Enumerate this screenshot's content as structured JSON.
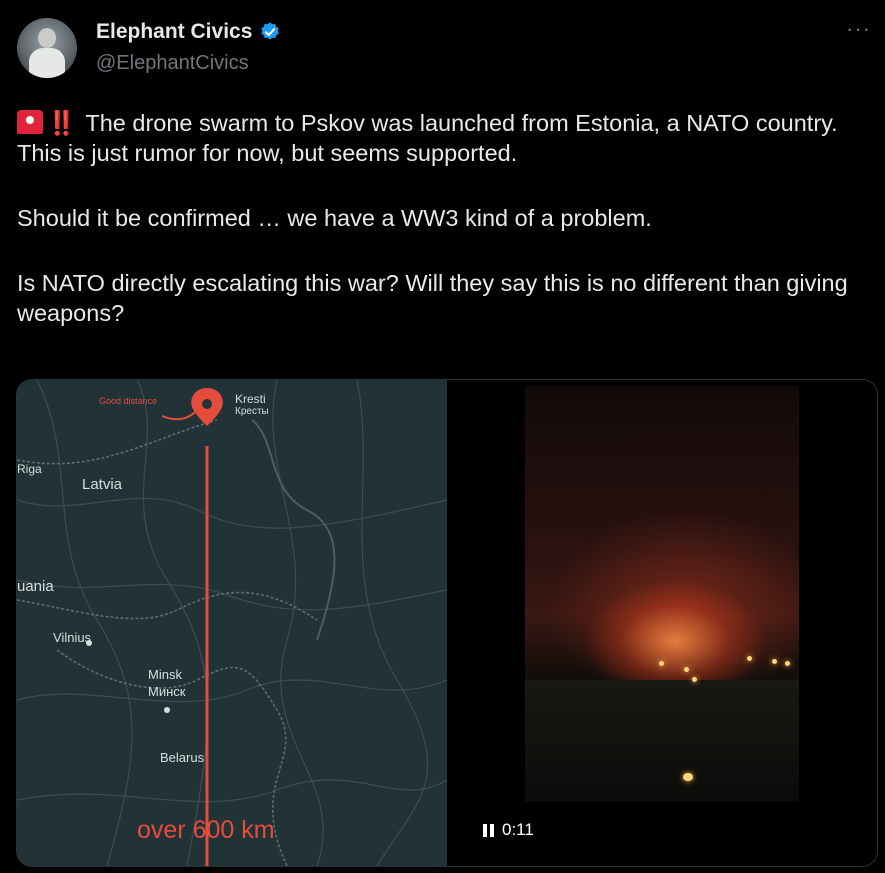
{
  "author": {
    "display_name": "Elephant Civics",
    "handle": "@ElephantCivics",
    "verified_icon": "verified-badge-icon",
    "verified_color": "#1d9bf0"
  },
  "more_label": "···",
  "tweet": {
    "p1_alert": "‼️",
    "p1_text": "The drone swarm to Pskov was launched from Estonia, a NATO country. This is just rumor for now, but seems supported.",
    "p2": "Should it be confirmed … we have a WW3 kind of a problem.",
    "p3": "Is NATO directly escalating this war? Will they say this is no different than giving weapons?"
  },
  "map": {
    "good_distance": "Good distance",
    "kresti": "Kresti",
    "kresti_cyr": "Кресты",
    "riga": "Riga",
    "latvia": "Latvia",
    "lithuania": "uania",
    "vilnius": "Vilnius",
    "minsk": "Minsk",
    "minsk_cyr": "Минск",
    "belarus": "Belarus",
    "distance": "over 600 km",
    "accent_color": "#e64c3c"
  },
  "video": {
    "time": "0:11"
  }
}
